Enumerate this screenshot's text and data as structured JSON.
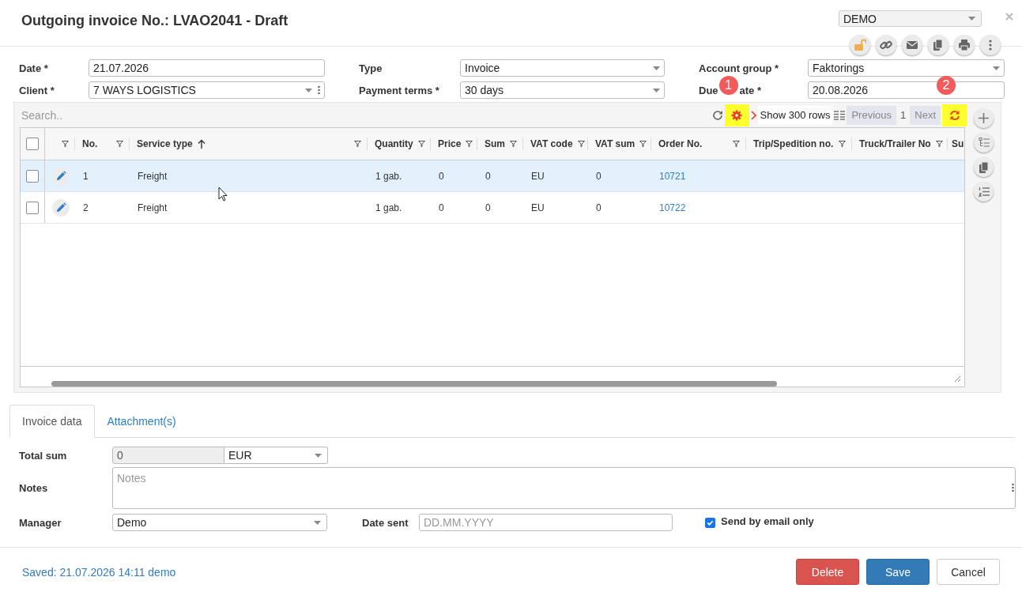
{
  "window": {
    "title": "Outgoing invoice No.: LVAO2041 - Draft",
    "company": "DEMO"
  },
  "form": {
    "fields": [
      {
        "label": "Date *",
        "value": "21.07.2026",
        "kind": "text"
      },
      {
        "label": "Type",
        "value": "Invoice",
        "kind": "select"
      },
      {
        "label": "Account group *",
        "value": "Faktorings",
        "kind": "select"
      },
      {
        "label": "Client *",
        "value": "7 WAYS LOGISTICS",
        "kind": "combo"
      },
      {
        "label": "Payment terms *",
        "value": "30 days",
        "kind": "select"
      },
      {
        "label": "Due",
        "label_after_callout": "ate *",
        "value": "20.08.2026",
        "kind": "text"
      }
    ]
  },
  "grid": {
    "search": {
      "placeholder": "Search.."
    },
    "settings_highlighted": true,
    "page_size": "Show 300 rows",
    "previous": "Previous",
    "page": "1",
    "next": "Next",
    "reload_highlighted": true,
    "callouts": [
      "1",
      "2"
    ],
    "header_checked": false,
    "columns": [
      {
        "label": "No.",
        "sorted_ascending": false
      },
      {
        "label": "Service type",
        "sorted_ascending": true
      },
      {
        "label": "Quantity",
        "sorted_ascending": false
      },
      {
        "label": "Price",
        "sorted_ascending": false
      },
      {
        "label": "Sum",
        "sorted_ascending": false
      },
      {
        "label": "VAT code",
        "sorted_ascending": false
      },
      {
        "label": "VAT sum",
        "sorted_ascending": false
      },
      {
        "label": "Order No.",
        "sorted_ascending": false
      },
      {
        "label": "Trip/Spedition no.",
        "sorted_ascending": false
      },
      {
        "label": "Truck/Trailer No",
        "sorted_ascending": false
      },
      {
        "label": "Su",
        "sorted_ascending": false
      }
    ],
    "rows": [
      {
        "checked": false,
        "highlighted": true,
        "no": "1",
        "service_type": "Freight",
        "quantity": "1 gab.",
        "price": "0",
        "sum": "0",
        "vat_code": "EU",
        "vat_sum": "0",
        "order_no": "10721"
      },
      {
        "checked": false,
        "highlighted": false,
        "no": "2",
        "service_type": "Freight",
        "quantity": "1 gab.",
        "price": "0",
        "sum": "0",
        "vat_code": "EU",
        "vat_sum": "0",
        "order_no": "10722"
      }
    ]
  },
  "tabs": [
    {
      "label": "Invoice data",
      "selected": true
    },
    {
      "label": "Attachment(s)",
      "selected": false
    }
  ],
  "details": {
    "total_sum": {
      "label": "Total sum",
      "value": "0",
      "currency": "EUR"
    },
    "notes": {
      "label": "Notes",
      "placeholder": "Notes"
    },
    "manager": {
      "label": "Manager",
      "value": "Demo"
    },
    "date_sent": {
      "label": "Date sent",
      "placeholder": "DD.MM.YYYY"
    },
    "send_by_email_only": {
      "label": "Send by email only",
      "checked": true
    }
  },
  "footer": {
    "saved": "Saved: 21.07.2026 14:11 demo",
    "buttons": [
      {
        "label": "Delete",
        "kind": "danger"
      },
      {
        "label": "Save",
        "kind": "primary"
      },
      {
        "label": "Cancel",
        "kind": "default"
      }
    ]
  }
}
